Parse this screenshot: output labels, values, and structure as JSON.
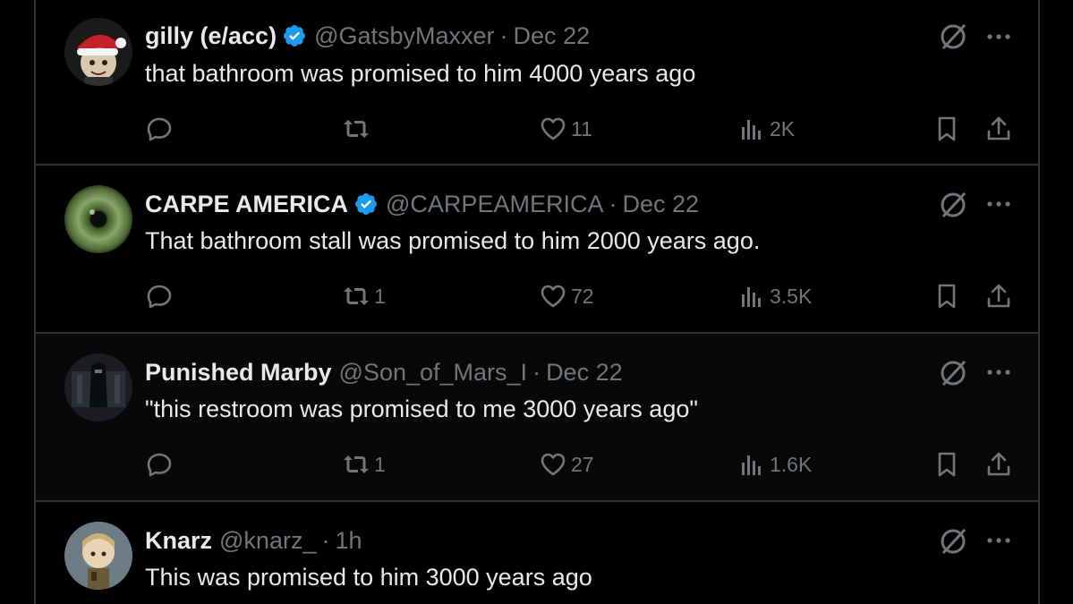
{
  "tweets": [
    {
      "name": "gilly (e/acc)",
      "verified": true,
      "handle": "@GatsbyMaxxer",
      "separator": "·",
      "time": "Dec 22",
      "text": "that bathroom was promised to him 4000 years ago",
      "replies": "",
      "retweets": "",
      "likes": "11",
      "views": "2K",
      "avatar": "santa-hat-character-avatar"
    },
    {
      "name": "CARPE AMERICA",
      "verified": true,
      "handle": "@CARPEAMERICA",
      "separator": "·",
      "time": "Dec 22",
      "text": "That bathroom stall was promised to him 2000 years ago.",
      "replies": "",
      "retweets": "1",
      "likes": "72",
      "views": "3.5K",
      "avatar": "green-eye-avatar"
    },
    {
      "name": "Punished Marby",
      "verified": false,
      "handle": "@Son_of_Mars_I",
      "separator": "·",
      "time": "Dec 22",
      "text": "\"this restroom was promised to me 3000 years ago\"",
      "replies": "",
      "retweets": "1",
      "likes": "27",
      "views": "1.6K",
      "avatar": "dark-figure-avatar"
    },
    {
      "name": "Knarz",
      "verified": false,
      "handle": "@knarz_",
      "separator": "·",
      "time": "1h",
      "text": "This was promised to him 3000 years ago",
      "avatar": "chibi-soldier-avatar"
    }
  ],
  "colors": {
    "background": "#000000",
    "text": "#e7e9ea",
    "muted": "#71767b",
    "verified_badge": "#1d9bf0",
    "divider": "#2f3336"
  },
  "icons": {
    "reply": "reply-icon",
    "retweet": "retweet-icon",
    "like": "heart-icon",
    "views": "views-icon",
    "bookmark": "bookmark-icon",
    "share": "share-icon",
    "grok": "grok-icon",
    "more": "more-icon",
    "verified": "verified-badge-icon"
  }
}
